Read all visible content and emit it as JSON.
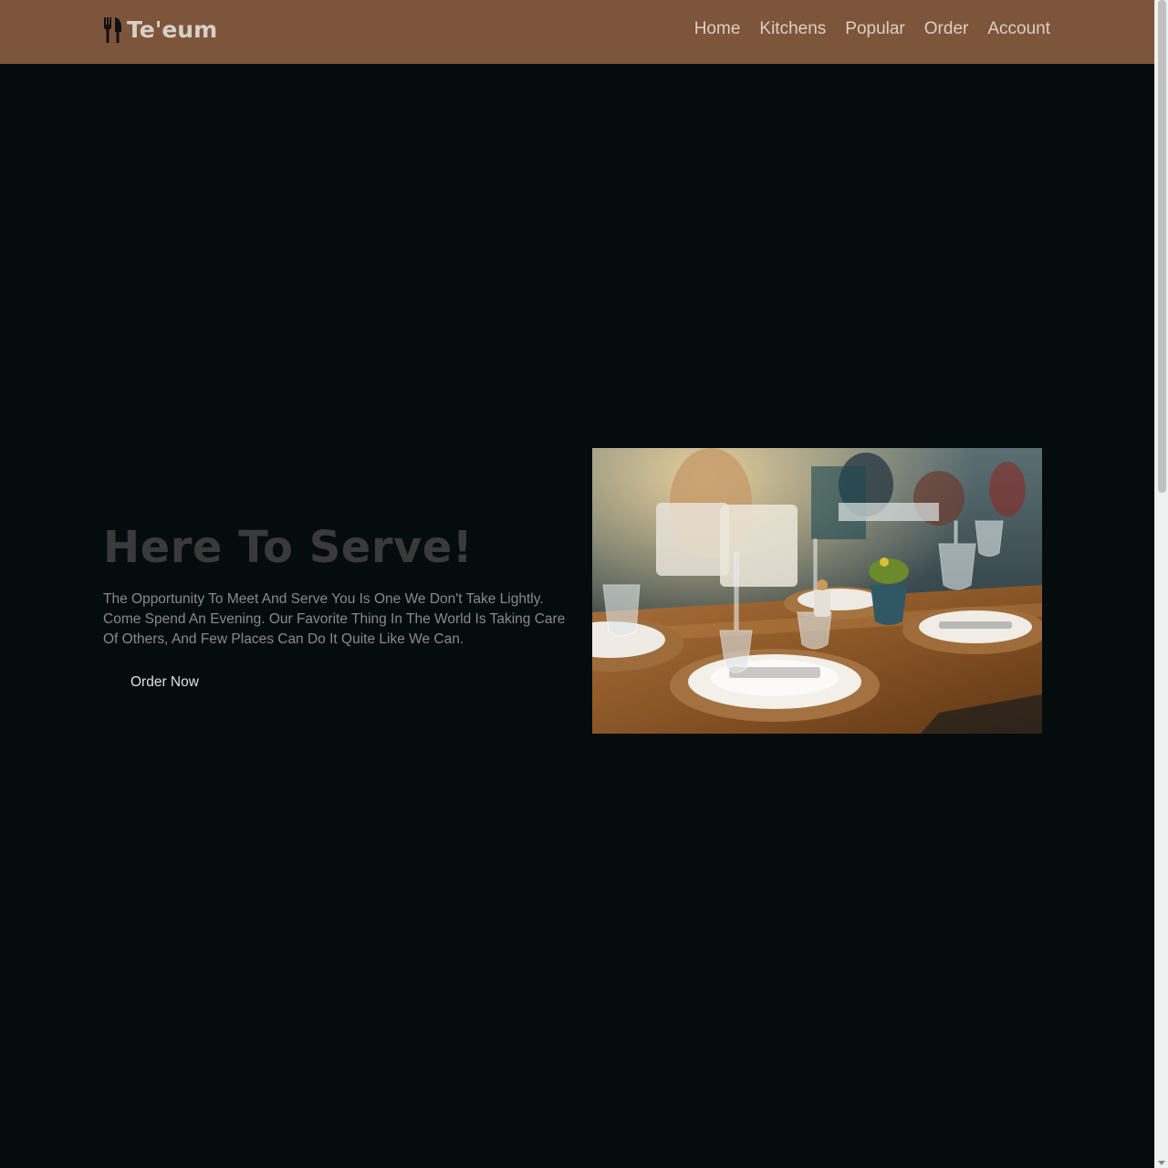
{
  "brand": {
    "name": "Te'eum",
    "icon": "utensils-icon"
  },
  "nav": {
    "items": [
      {
        "label": "Home"
      },
      {
        "label": "Kitchens"
      },
      {
        "label": "Popular"
      },
      {
        "label": "Order"
      },
      {
        "label": "Account"
      }
    ]
  },
  "hero": {
    "title": "Here To Serve!",
    "text": "The Opportunity To Meet And Serve You Is One We Don't Take Lightly. Come Spend An Evening. Our Favorite Thing In The World Is Taking Care Of Others, And Few Places Can Do It Quite Like We Can.",
    "button_label": "Order Now",
    "image": "restaurant-table-photo"
  },
  "colors": {
    "navbar": "#7d553b",
    "background": "#050c0d"
  }
}
